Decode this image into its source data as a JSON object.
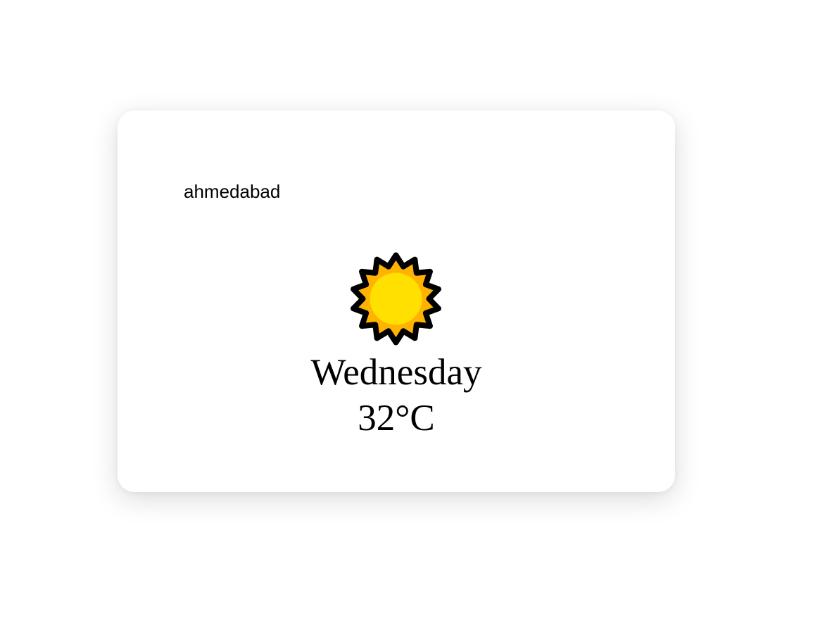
{
  "weather": {
    "city_value": "ahmedabad",
    "icon": "sun-icon",
    "day": "Wednesday",
    "temperature": "32°C"
  },
  "colors": {
    "sun_rays": "#FFB300",
    "sun_core": "#FFE000",
    "sun_outline": "#000000",
    "card_background": "#FFFFFF"
  }
}
